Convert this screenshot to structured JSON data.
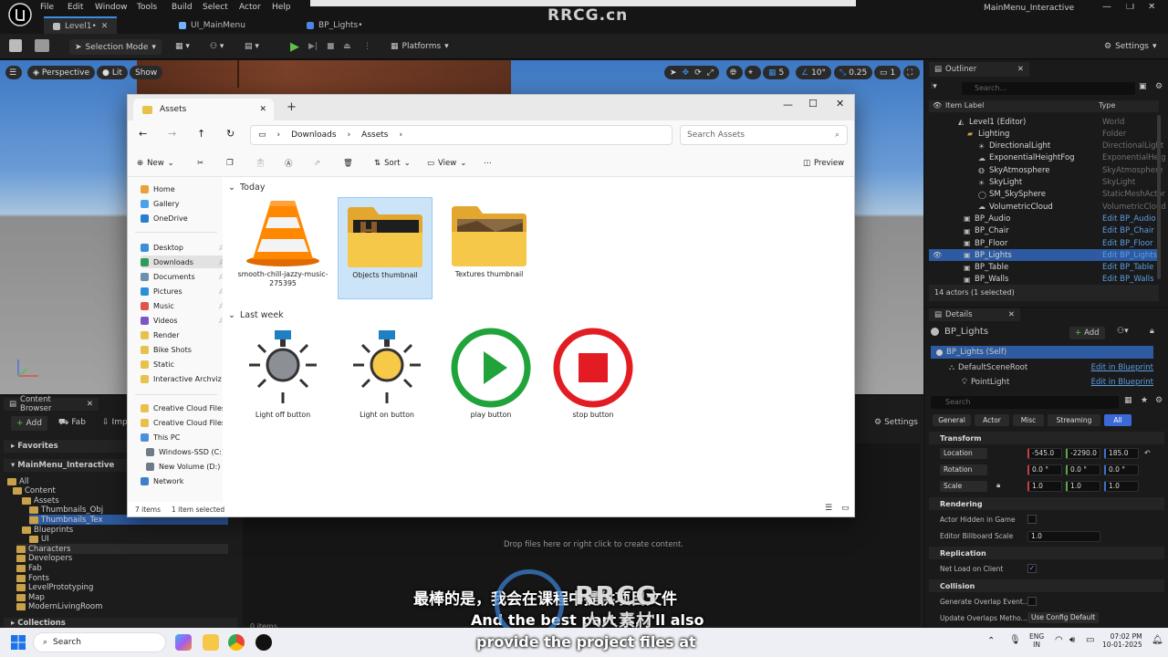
{
  "editor": {
    "menu": [
      "File",
      "Edit",
      "Window",
      "Tools",
      "Build",
      "Select",
      "Actor",
      "Help"
    ],
    "tabs": [
      {
        "label": "Level1•",
        "active": true
      },
      {
        "label": "UI_MainMenu",
        "active": false
      },
      {
        "label": "BP_Lights•",
        "active": false
      }
    ],
    "project_name": "MainMenu_Interactive",
    "watermark_top": "RRCG.cn",
    "toolbar": {
      "selection_mode": "Selection Mode",
      "platforms": "Platforms",
      "settings": "Settings"
    },
    "viewport": {
      "perspective": "Perspective",
      "lit": "Lit",
      "show": "Show",
      "grid_snap": "5",
      "rot_snap": "10°",
      "scale_snap": "0.25",
      "cam_speed": "1"
    }
  },
  "outliner": {
    "title": "Outliner",
    "search_placeholder": "Search...",
    "col_label": "Item Label",
    "col_type": "Type",
    "rows": [
      {
        "label": "Level1 (Editor)",
        "type": "World",
        "link": false
      },
      {
        "label": "Lighting",
        "type": "Folder",
        "link": false
      },
      {
        "label": "DirectionalLight",
        "type": "DirectionalLight",
        "link": false
      },
      {
        "label": "ExponentialHeightFog",
        "type": "ExponentialHeig",
        "link": false
      },
      {
        "label": "SkyAtmosphere",
        "type": "SkyAtmosphere",
        "link": false
      },
      {
        "label": "SkyLight",
        "type": "SkyLight",
        "link": false
      },
      {
        "label": "SM_SkySphere",
        "type": "StaticMeshActor",
        "link": false
      },
      {
        "label": "VolumetricCloud",
        "type": "VolumetricCloud",
        "link": false
      },
      {
        "label": "BP_Audio",
        "type": "Edit BP_Audio",
        "link": true
      },
      {
        "label": "BP_Chair",
        "type": "Edit BP_Chair",
        "link": true
      },
      {
        "label": "BP_Floor",
        "type": "Edit BP_Floor",
        "link": true
      },
      {
        "label": "BP_Lights",
        "type": "Edit BP_Lights",
        "link": true
      },
      {
        "label": "BP_Table",
        "type": "Edit BP_Table",
        "link": true
      },
      {
        "label": "BP_Walls",
        "type": "Edit BP_Walls",
        "link": true
      }
    ],
    "footer": "14 actors (1 selected)"
  },
  "details": {
    "title": "Details",
    "actor": "BP_Lights",
    "add": "Add",
    "components": [
      {
        "label": "BP_Lights (Self)",
        "link": ""
      },
      {
        "label": "DefaultSceneRoot",
        "link": "Edit in Blueprint"
      },
      {
        "label": "PointLight",
        "link": "Edit in Blueprint"
      }
    ],
    "search_placeholder": "Search",
    "filters": [
      "General",
      "Actor",
      "Misc",
      "Streaming",
      "All"
    ],
    "transform": {
      "title": "Transform",
      "location": {
        "label": "Location",
        "values": [
          "-545.0",
          "-2290.0",
          "185.0"
        ]
      },
      "rotation": {
        "label": "Rotation",
        "values": [
          "0.0 °",
          "0.0 °",
          "0.0 °"
        ]
      },
      "scale": {
        "label": "Scale",
        "values": [
          "1.0",
          "1.0",
          "1.0"
        ]
      }
    },
    "rendering": {
      "title": "Rendering",
      "actor_hidden": "Actor Hidden in Game",
      "billboard": "Editor Billboard Scale",
      "billboard_value": "1.0"
    },
    "replication": {
      "title": "Replication",
      "net_load": "Net Load on Client"
    },
    "collision": {
      "title": "Collision",
      "gen_overlap": "Generate Overlap Event...",
      "update_overlap": "Update Overlaps Metho...",
      "update_value": "Use Config Default"
    }
  },
  "content_browser": {
    "title": "Content Browser",
    "add": "Add",
    "fab": "Fab",
    "import": "Imp",
    "settings": "Settings",
    "favorites": "Favorites",
    "project": "MainMenu_Interactive",
    "tree": [
      "All",
      "Content",
      "Assets",
      "Thumbnails_Obj",
      "Thumbnails_Tex",
      "Blueprints",
      "UI",
      "Characters",
      "Developers",
      "Fab",
      "Fonts",
      "LevelPrototyping",
      "Map",
      "ModernLivingRoom"
    ],
    "collections": "Collections",
    "drop_hint": "Drop files here or right click to create content.",
    "item_count": "0 items"
  },
  "explorer": {
    "tab_title": "Assets",
    "breadcrumb": [
      "Downloads",
      "Assets"
    ],
    "search_placeholder": "Search Assets",
    "commands": {
      "new": "New",
      "sort": "Sort",
      "view": "View",
      "preview": "Preview"
    },
    "nav": [
      {
        "label": "Home",
        "color": "#e8a13a",
        "pin": false
      },
      {
        "label": "Gallery",
        "color": "#4aa3e8",
        "pin": false
      },
      {
        "label": "OneDrive",
        "color": "#2b7cd3",
        "pin": false
      },
      {
        "label": "Desktop",
        "color": "#3b8fd9",
        "pin": true
      },
      {
        "label": "Downloads",
        "color": "#2e9b5b",
        "pin": true
      },
      {
        "label": "Documents",
        "color": "#6d8fb0",
        "pin": true
      },
      {
        "label": "Pictures",
        "color": "#2a8fd6",
        "pin": true
      },
      {
        "label": "Music",
        "color": "#e2544a",
        "pin": true
      },
      {
        "label": "Videos",
        "color": "#7a55c8",
        "pin": true
      },
      {
        "label": "Render",
        "color": "#e8c14c",
        "pin": false
      },
      {
        "label": "Bike Shots",
        "color": "#e8c14c",
        "pin": false
      },
      {
        "label": "Static",
        "color": "#e8c14c",
        "pin": false
      },
      {
        "label": "Interactive Archviz",
        "color": "#e8c14c",
        "pin": false
      },
      {
        "label": "Creative Cloud Files",
        "color": "#e8c14c",
        "pin": false
      },
      {
        "label": "Creative Cloud Files",
        "color": "#e8c14c",
        "pin": false
      },
      {
        "label": "This PC",
        "color": "#4a90d9",
        "pin": false
      },
      {
        "label": "Windows-SSD (C:)",
        "color": "#6f7b88",
        "pin": false
      },
      {
        "label": "New Volume (D:)",
        "color": "#6f7b88",
        "pin": false
      },
      {
        "label": "Network",
        "color": "#3d7fc9",
        "pin": false
      }
    ],
    "group_today": "Today",
    "group_lastweek": "Last week",
    "files_today": [
      "smooth-chill-jazzy-music-275395",
      "Objects thumbnail",
      "Textures thumbnail"
    ],
    "files_lastweek": [
      "Light off button",
      "Light on button",
      "play button",
      "stop button"
    ],
    "status_count": "7 items",
    "status_selected": "1 item selected"
  },
  "overlay": {
    "subtitle_cn": "最棒的是，我会在课程中提供项目文件",
    "subtitle_en1": "And the best part is, I'll also",
    "subtitle_en2": "provide the project files at",
    "watermark": "RRCG",
    "watermark_cn": "人人素材"
  },
  "taskbar": {
    "search": "Search",
    "lang1": "ENG",
    "lang2": "IN",
    "time": "07:02 PM",
    "date": "10-01-2025"
  }
}
